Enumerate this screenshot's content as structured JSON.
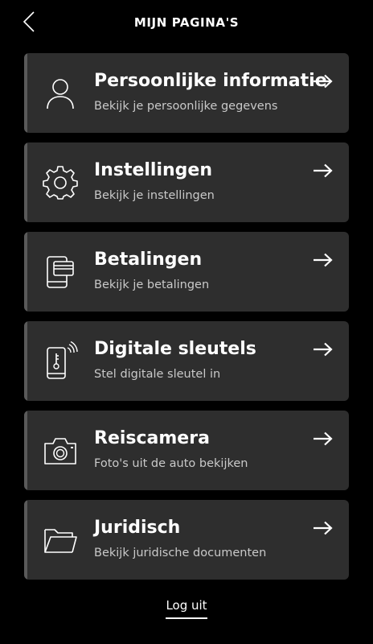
{
  "header": {
    "title": "MIJN PAGINA'S",
    "back_icon": "chevron-left-icon"
  },
  "cards": [
    {
      "title": "Persoonlijke informatie",
      "subtitle": "Bekijk je persoonlijke gegevens",
      "icon": "person-icon"
    },
    {
      "title": "Instellingen",
      "subtitle": "Bekijk je instellingen",
      "icon": "gear-icon"
    },
    {
      "title": "Betalingen",
      "subtitle": "Bekijk je betalingen",
      "icon": "payment-card-phone-icon"
    },
    {
      "title": "Digitale sleutels",
      "subtitle": "Stel digitale sleutel in",
      "icon": "digital-key-phone-icon"
    },
    {
      "title": "Reiscamera",
      "subtitle": "Foto's uit de auto bekijken",
      "icon": "camera-icon"
    },
    {
      "title": "Juridisch",
      "subtitle": "Bekijk juridische documenten",
      "icon": "folder-icon"
    }
  ],
  "footer": {
    "logout_label": "Log uit"
  },
  "colors": {
    "background": "#000000",
    "card": "#2e2e2e",
    "card_edge": "#5a5a5a",
    "subtitle": "#c9c9c9"
  }
}
